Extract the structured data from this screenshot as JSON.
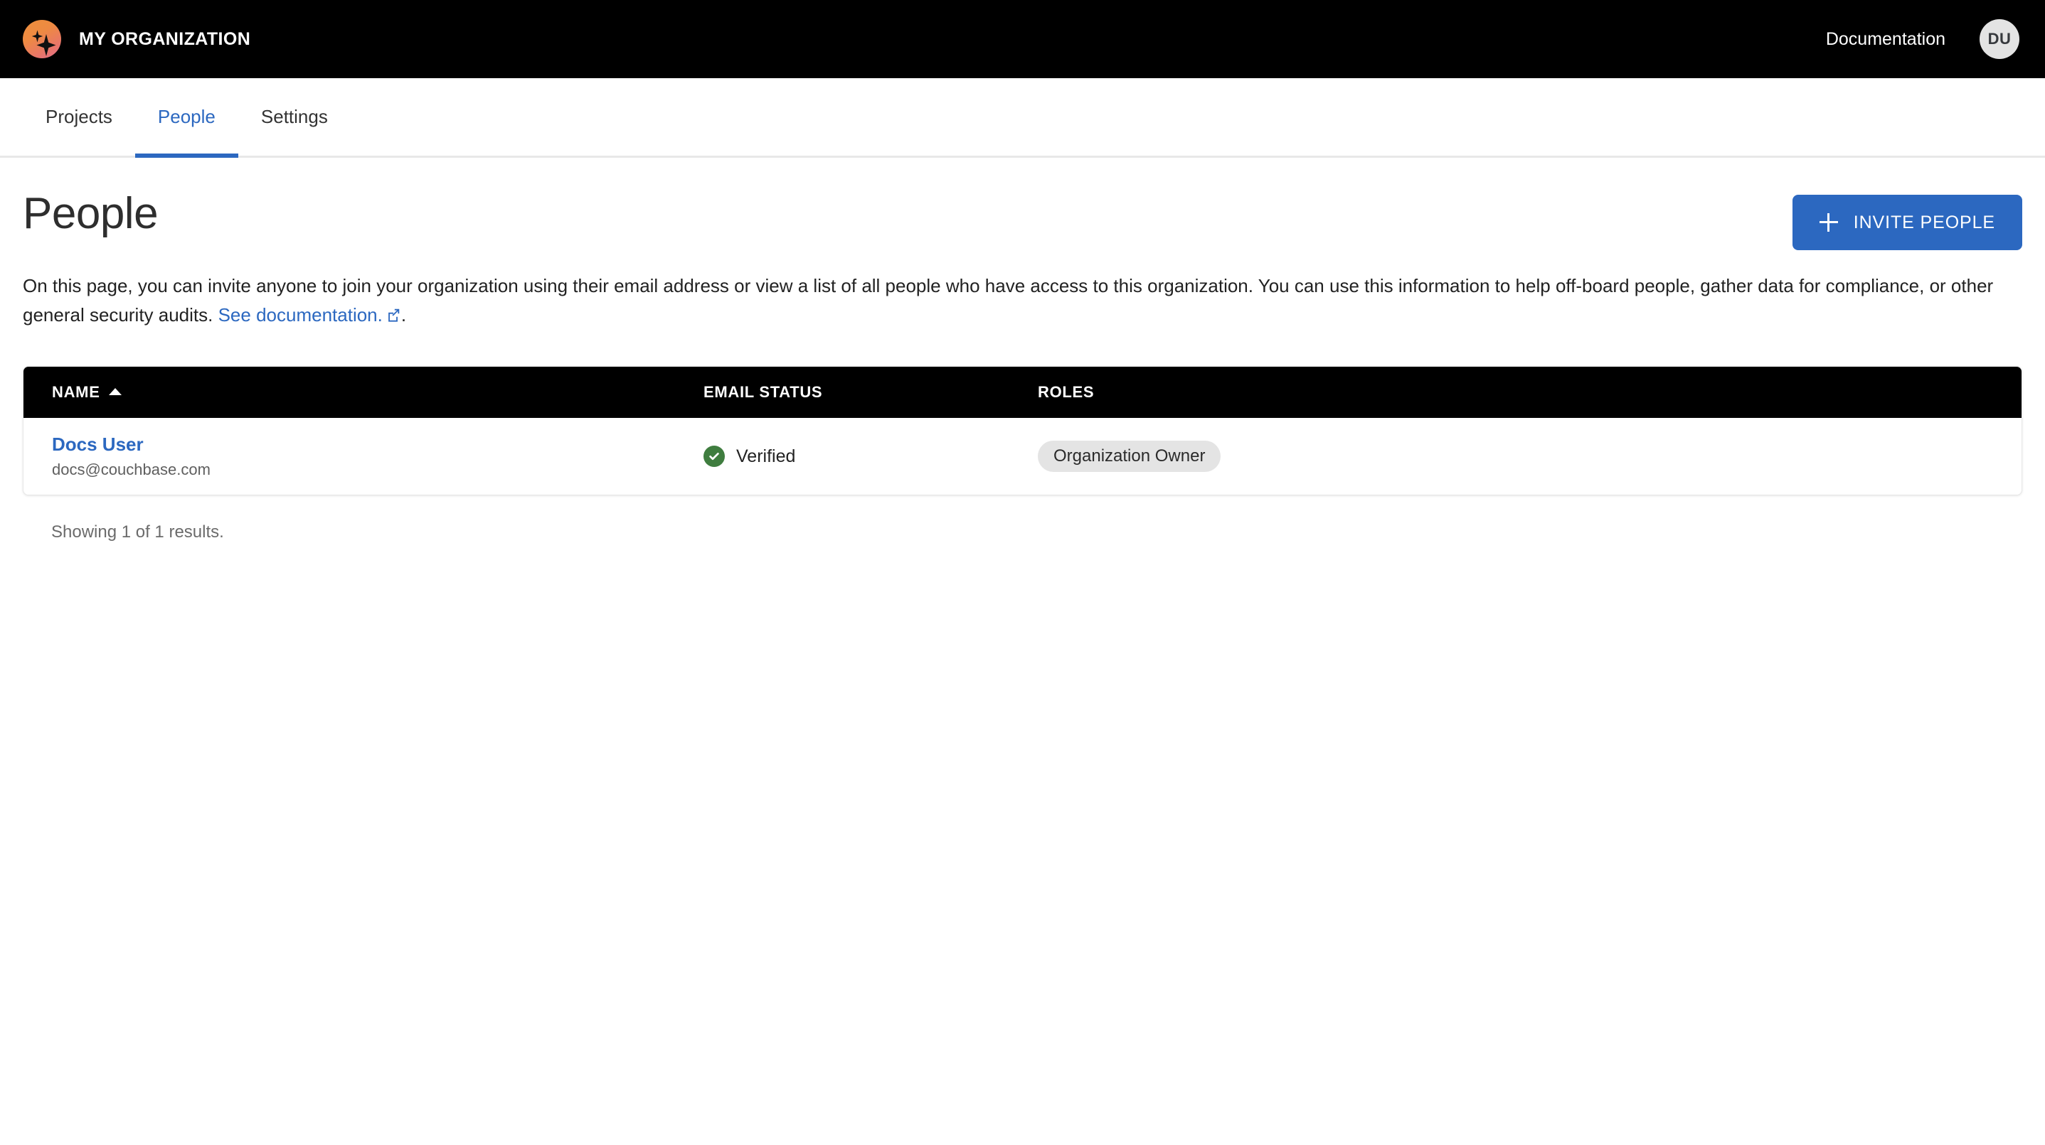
{
  "topbar": {
    "logo_icon": "sparkle-logo-icon",
    "org_title": "MY ORGANIZATION",
    "documentation_link": "Documentation",
    "avatar_initials": "DU",
    "background_color": "#000000",
    "logo_gradient_from": "#ef8f3c",
    "logo_gradient_to": "#e4708f"
  },
  "tabs": [
    {
      "label": "Projects",
      "active": false
    },
    {
      "label": "People",
      "active": true
    },
    {
      "label": "Settings",
      "active": false
    }
  ],
  "page": {
    "title": "People",
    "invite_button_label": "INVITE PEOPLE",
    "invite_button_icon": "plus-icon",
    "description_part1": "On this page, you can invite anyone to join your organization using their email address or view a list of all people who have access to this organization. You can use this information to help off-board people, gather data for compliance, or other general security audits. ",
    "description_link": "See documentation.",
    "description_link_icon": "external-link-icon",
    "description_part2": ".",
    "accent_color": "#2c68c0"
  },
  "table": {
    "columns": [
      {
        "label": "NAME",
        "sort": "ascending"
      },
      {
        "label": "EMAIL STATUS",
        "sort": "none"
      },
      {
        "label": "ROLES",
        "sort": "none"
      }
    ],
    "rows": [
      {
        "name": "Docs User",
        "email": "docs@couchbase.com",
        "email_status": "Verified",
        "email_status_icon": "verified-check-icon",
        "email_status_color": "#3f7d3f",
        "roles": [
          "Organization Owner"
        ]
      }
    ],
    "header_background": "#000000"
  },
  "footer": {
    "results_note": "Showing 1 of 1 results."
  }
}
